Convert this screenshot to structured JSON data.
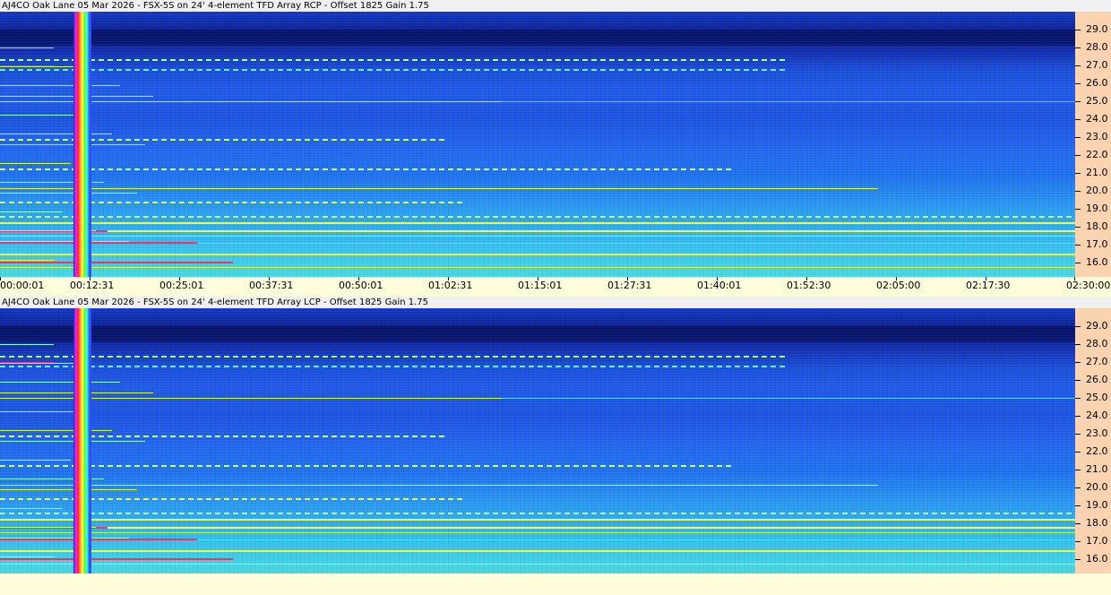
{
  "panels": [
    {
      "title": "AJ4CO Oak Lane 05 Mar 2026 - FSX-5S on 24' 4-element TFD Array RCP  -  Offset 1825  Gain 1.75",
      "freq_labels": [
        "29.0",
        "28.0",
        "27.0",
        "26.0",
        "25.0",
        "24.0",
        "23.0",
        "22.0",
        "21.0",
        "20.0",
        "19.0",
        "18.0",
        "17.0",
        "16.0"
      ],
      "time_labels": [
        "00:00:01",
        "00:12:31",
        "00:25:01",
        "00:37:31",
        "00:50:01",
        "01:02:31",
        "01:15:01",
        "01:27:31",
        "01:40:01",
        "01:52:30",
        "02:05:00",
        "02:17:30",
        "02:30:00"
      ]
    },
    {
      "title": "AJ4CO Oak Lane 05 Mar 2026 - FSX-5S on 24' 4-element TFD Array LCP  -  Offset 1825  Gain 1.75",
      "freq_labels": [
        "29.0",
        "28.0",
        "27.0",
        "26.0",
        "25.0",
        "24.0",
        "23.0",
        "22.0",
        "21.0",
        "20.0",
        "19.0",
        "18.0",
        "17.0",
        "16.0"
      ]
    }
  ],
  "colors": {
    "background": "#fffcdc",
    "freq_axis_bg": "#fbd3b0",
    "spectrogram_low": "#0a1e8a",
    "spectrogram_high": "#48d8e0",
    "signal_line": "#f0ff40",
    "interference": "#ff3060"
  }
}
